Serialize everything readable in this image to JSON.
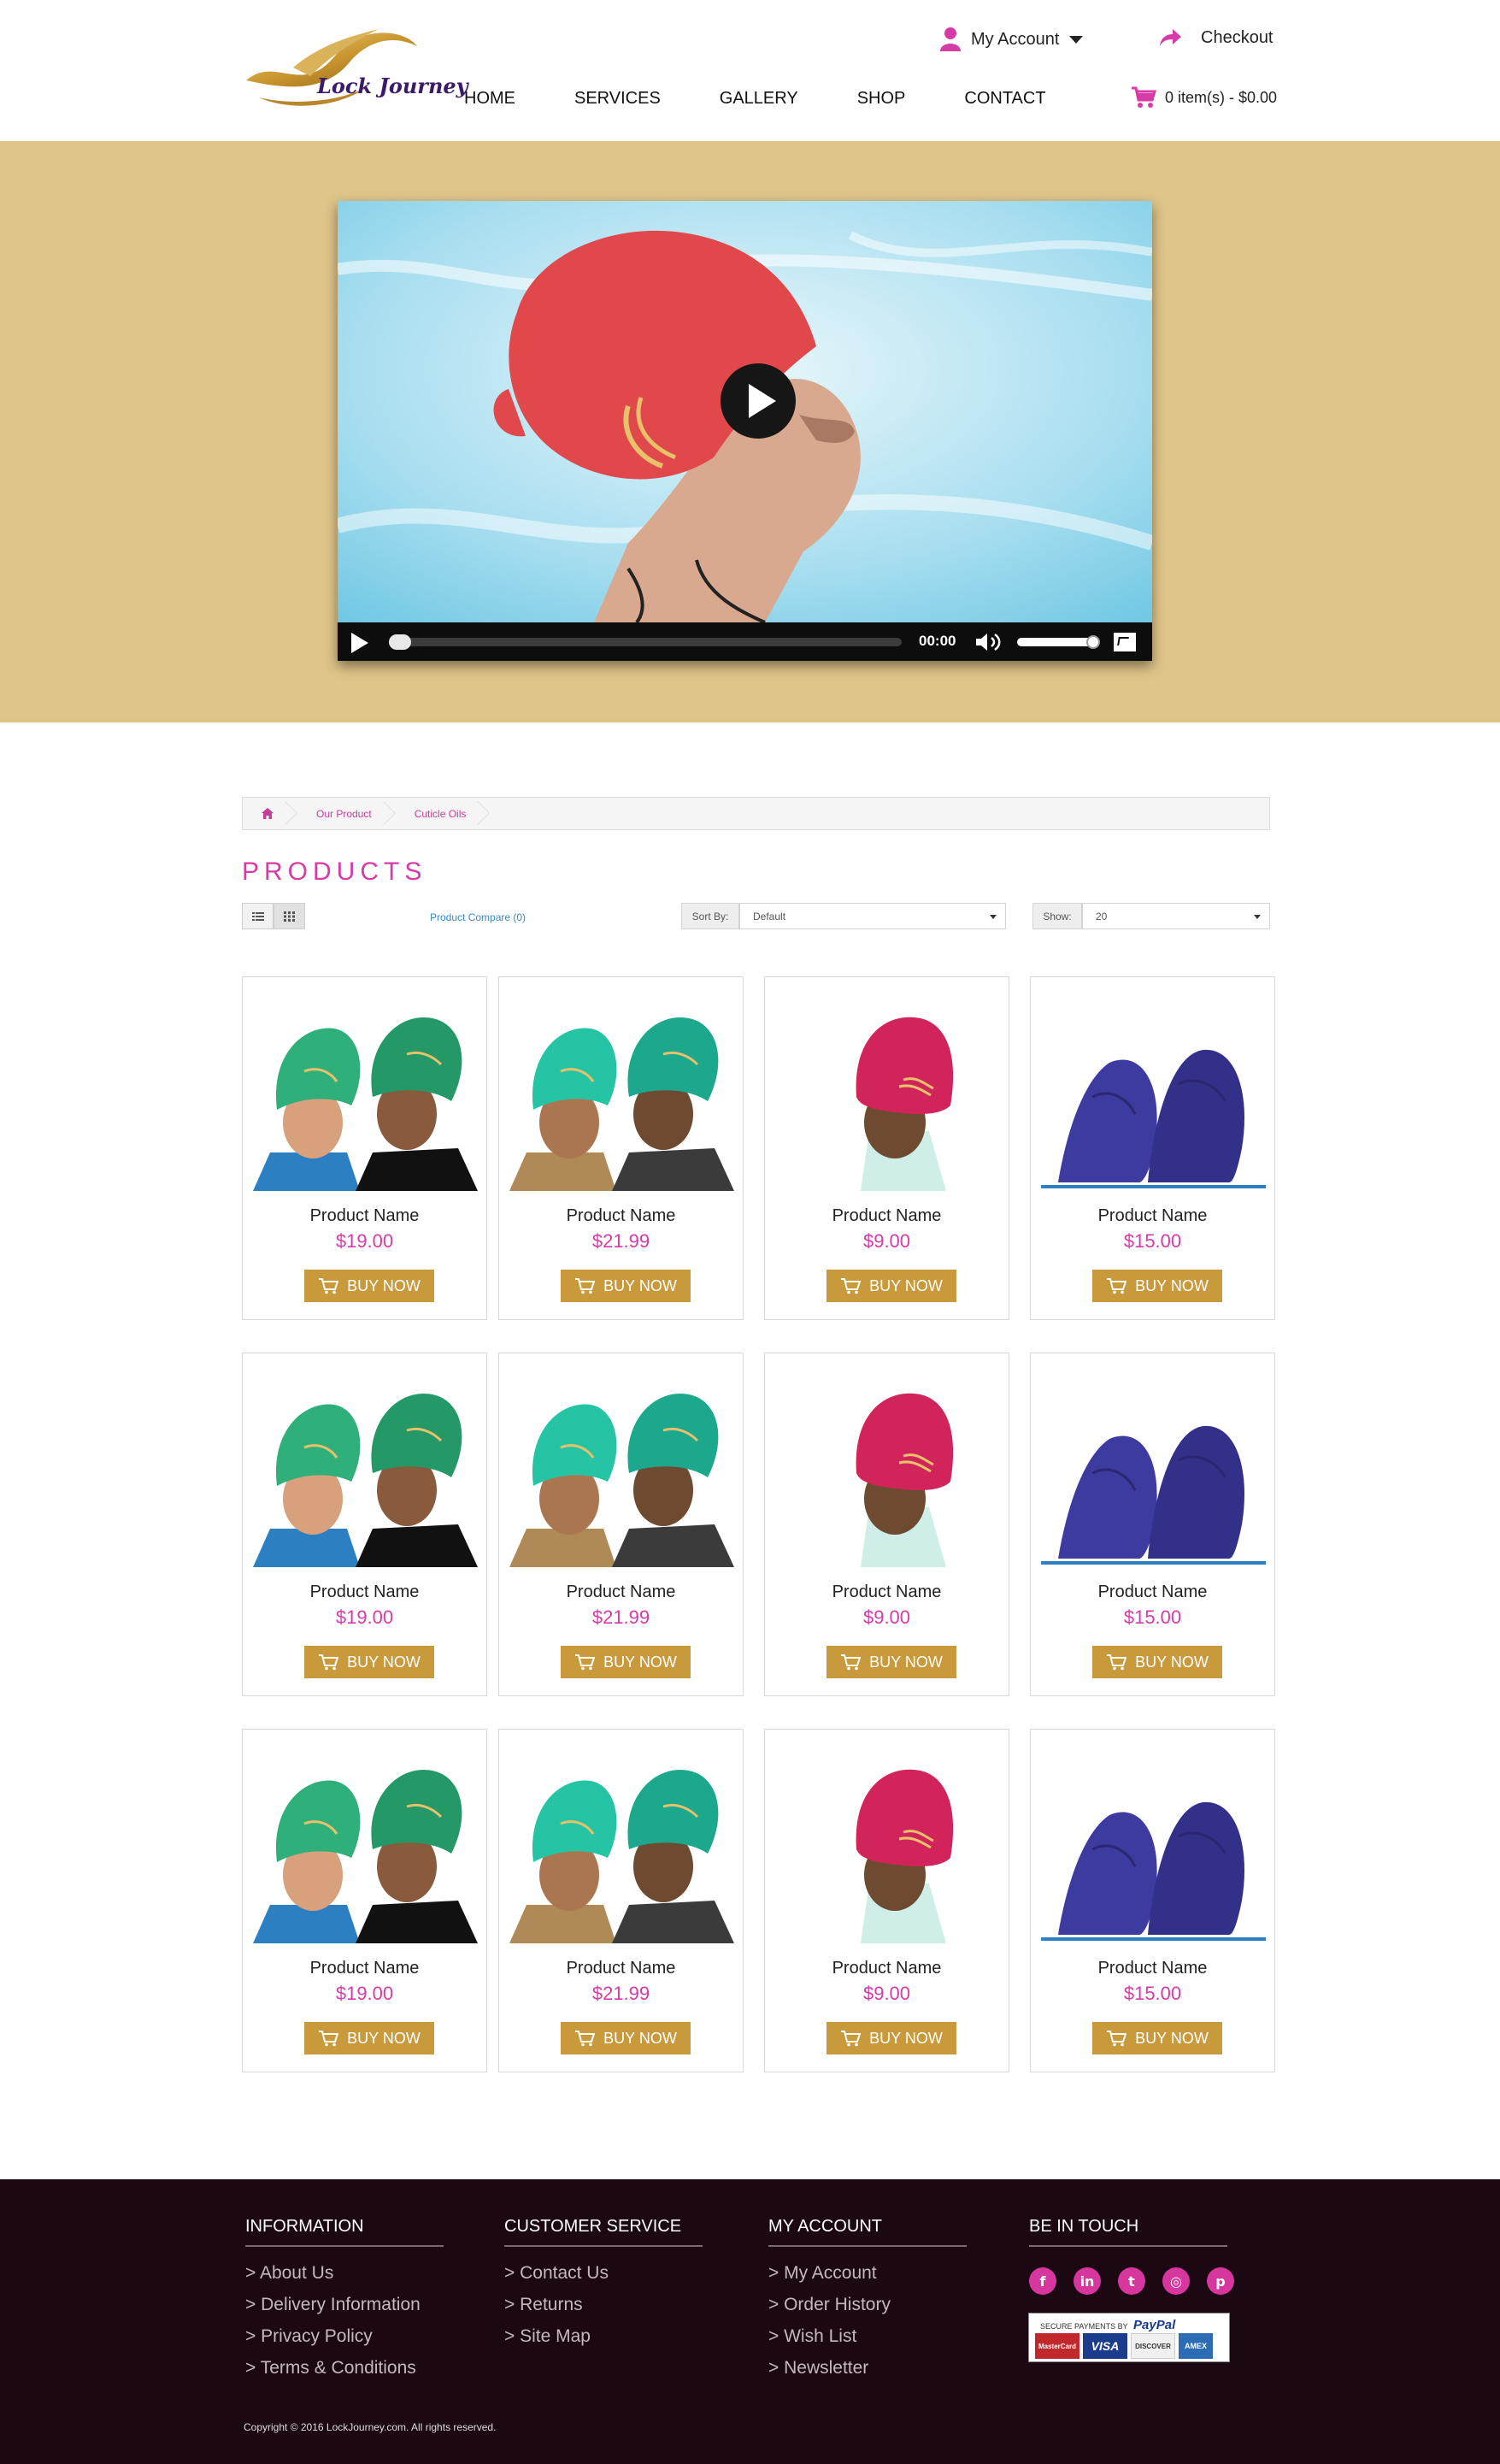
{
  "header": {
    "logo_text": "Lock Journey",
    "account_label": "My Account",
    "checkout_label": "Checkout",
    "cart_label": "0 item(s) - $0.00",
    "nav": [
      "HOME",
      "SERVICES",
      "GALLERY",
      "SHOP",
      "CONTACT"
    ]
  },
  "video": {
    "time": "00:00",
    "progress": 0,
    "volume": 0.9
  },
  "breadcrumb": [
    "Our Product",
    "Cuticle Oils"
  ],
  "products_section": {
    "title": "PRODUCTS",
    "compare_label": "Product Compare (0)",
    "sort_label": "Sort By:",
    "sort_value": "Default",
    "show_label": "Show:",
    "show_value": "20"
  },
  "products": [
    {
      "name": "Product Name",
      "price": "$19.00",
      "button": "BUY NOW",
      "image": "green-caps"
    },
    {
      "name": "Product Name",
      "price": "$21.99",
      "button": "BUY NOW",
      "image": "teal-caps"
    },
    {
      "name": "Product Name",
      "price": "$9.00",
      "button": "BUY NOW",
      "image": "red-cap"
    },
    {
      "name": "Product Name",
      "price": "$15.00",
      "button": "BUY NOW",
      "image": "blue-caps"
    },
    {
      "name": "Product Name",
      "price": "$19.00",
      "button": "BUY NOW",
      "image": "green-caps"
    },
    {
      "name": "Product Name",
      "price": "$21.99",
      "button": "BUY NOW",
      "image": "teal-caps"
    },
    {
      "name": "Product Name",
      "price": "$9.00",
      "button": "BUY NOW",
      "image": "red-cap"
    },
    {
      "name": "Product Name",
      "price": "$15.00",
      "button": "BUY NOW",
      "image": "blue-caps"
    },
    {
      "name": "Product Name",
      "price": "$19.00",
      "button": "BUY NOW",
      "image": "green-caps"
    },
    {
      "name": "Product Name",
      "price": "$21.99",
      "button": "BUY NOW",
      "image": "teal-caps"
    },
    {
      "name": "Product Name",
      "price": "$9.00",
      "button": "BUY NOW",
      "image": "red-cap"
    },
    {
      "name": "Product Name",
      "price": "$15.00",
      "button": "BUY NOW",
      "image": "blue-caps"
    }
  ],
  "footer": {
    "information": {
      "heading": "INFORMATION",
      "links": [
        "> About Us",
        "> Delivery Information",
        "> Privacy Policy",
        "> Terms & Conditions"
      ]
    },
    "customer_service": {
      "heading": "CUSTOMER SERVICE",
      "links": [
        "> Contact Us",
        "> Returns",
        "> Site Map"
      ]
    },
    "my_account": {
      "heading": "MY ACCOUNT",
      "links": [
        "> My Account",
        "> Order History",
        "> Wish List",
        "> Newsletter"
      ]
    },
    "be_in_touch": {
      "heading": "BE IN TOUCH",
      "social": [
        "facebook-icon",
        "linkedin-icon",
        "twitter-icon",
        "instagram-icon",
        "pinterest-icon"
      ],
      "paypal_text": "SECURE PAYMENTS BY",
      "paypal_brand": "PayPal",
      "cards": [
        "MasterCard",
        "VISA",
        "DISCOVER",
        "AMEX"
      ]
    },
    "copyright": "Copyright © 2016 LockJourney.com. All rights reserved."
  },
  "colors": {
    "accent_pink": "#d63ba8",
    "gold": "#c99a3c",
    "hero_bg": "#e0c58a",
    "footer_bg": "#1b0813"
  }
}
